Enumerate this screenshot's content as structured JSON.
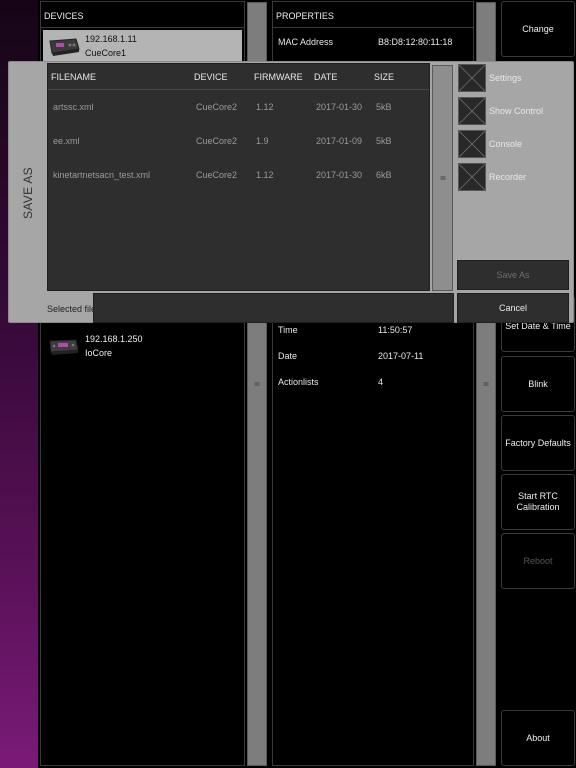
{
  "devices_panel": {
    "header": "DEVICES",
    "devices": [
      {
        "ip": "192.168.1.11",
        "name": "CueCore1",
        "selected": true
      },
      {
        "ip": "192.168.1.250",
        "name": "IoCore",
        "selected": false
      }
    ]
  },
  "properties_panel": {
    "header": "PROPERTIES",
    "top_rows": [
      {
        "key": "MAC Address",
        "value": "B8:D8:12:80:11:18"
      }
    ],
    "bottom_rows": [
      {
        "key": "Time",
        "value": "11:50:57"
      },
      {
        "key": "Date",
        "value": "2017-07-11"
      },
      {
        "key": "Actionlists",
        "value": "4"
      }
    ]
  },
  "actions": {
    "change": "Change",
    "set_date_time": "Set Date & Time",
    "blink": "Blink",
    "factory_defaults": "Factory Defaults",
    "start_rtc_line1": "Start RTC",
    "start_rtc_line2": "Calibration",
    "reboot": "Reboot",
    "about": "About"
  },
  "save_dialog": {
    "title": "SAVE AS",
    "columns": {
      "filename": "FILENAME",
      "device": "DEVICE",
      "firmware": "FIRMWARE",
      "date": "DATE",
      "size": "SIZE"
    },
    "files": [
      {
        "filename": "artssc.xml",
        "device": "CueCore2",
        "firmware": "1.12",
        "date": "2017-01-30",
        "size": "5kB"
      },
      {
        "filename": "ee.xml",
        "device": "CueCore2",
        "firmware": "1.9",
        "date": "2017-01-09",
        "size": "5kB"
      },
      {
        "filename": "kinetartnetsacn_test.xml",
        "device": "CueCore2",
        "firmware": "1.12",
        "date": "2017-01-30",
        "size": "6kB"
      }
    ],
    "types": [
      {
        "label": "Settings"
      },
      {
        "label": "Show Control"
      },
      {
        "label": "Console"
      },
      {
        "label": "Recorder"
      }
    ],
    "selected_file_label": "Selected file",
    "selected_file_value": "",
    "save_button": "Save As",
    "cancel_button": "Cancel"
  },
  "colors": {
    "accent_bg": "#7a1a78",
    "selected_row": "#b4b4b4",
    "dialog_frame": "#a6a6a6"
  }
}
